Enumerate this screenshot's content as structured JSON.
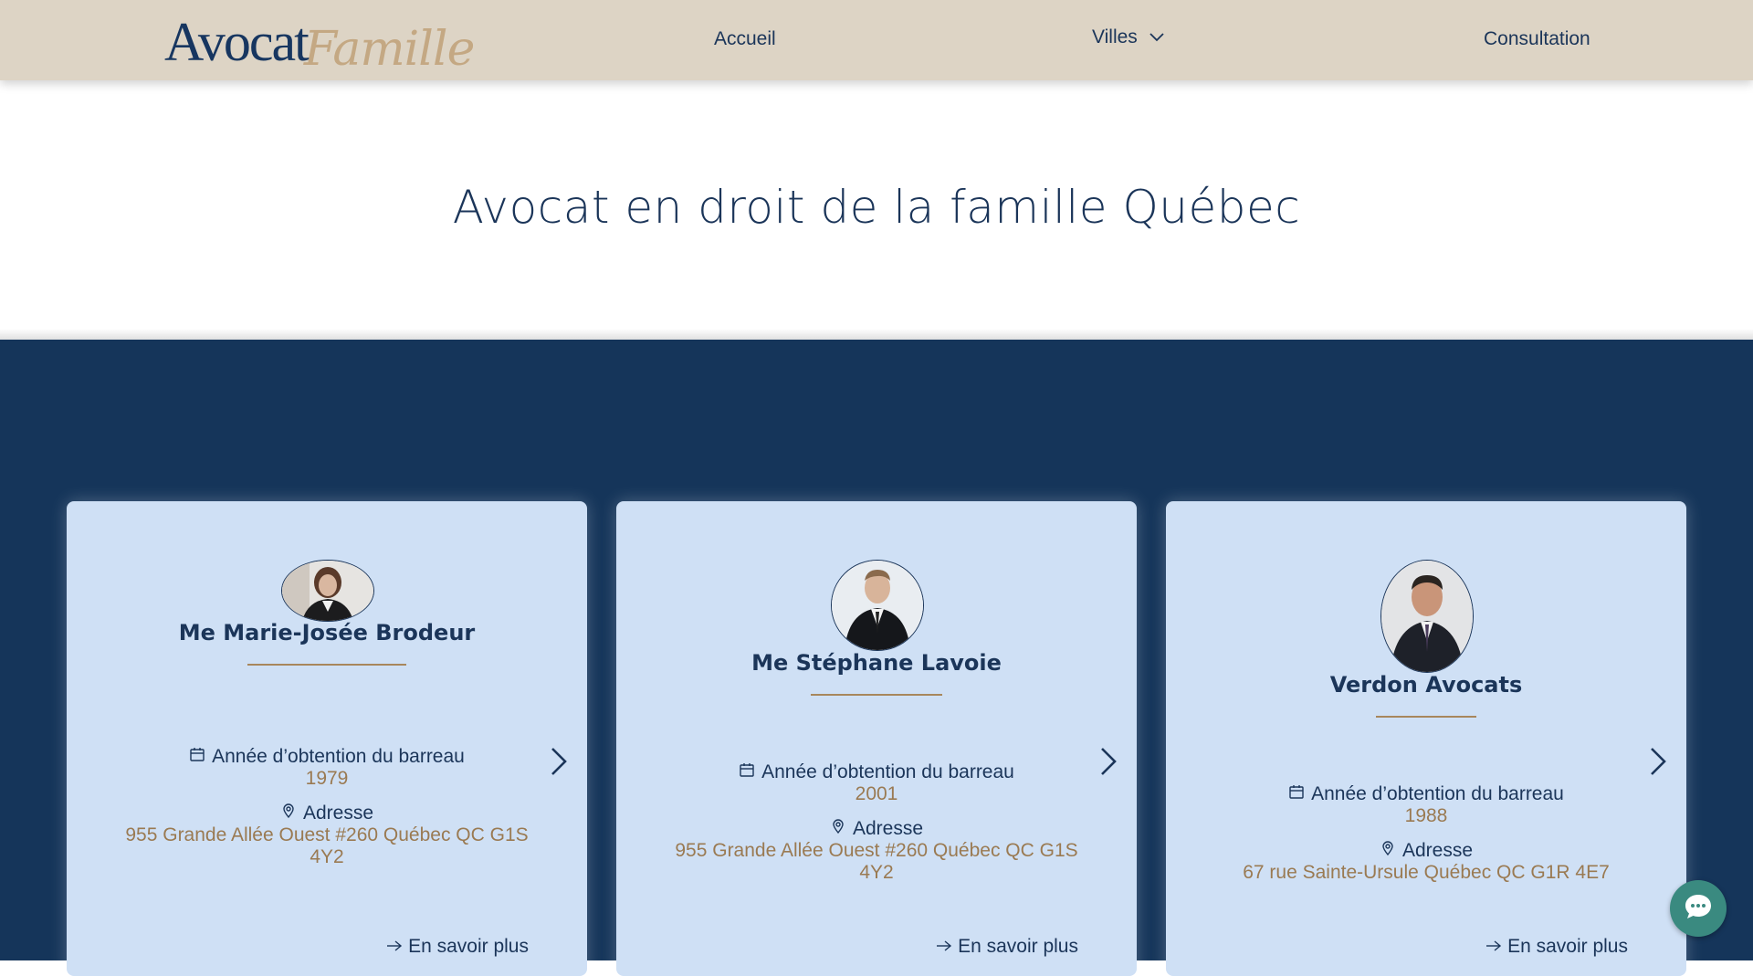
{
  "header": {
    "logo_part1": "Avocat",
    "logo_part2": "Famille",
    "nav": {
      "home": "Accueil",
      "cities": "Villes",
      "consultation": "Consultation"
    }
  },
  "hero": {
    "title": "Avocat en droit de la famille Québec"
  },
  "cards": [
    {
      "name": "Me Marie-Josée Brodeur",
      "year_label": "Année d’obtention du barreau",
      "year": "1979",
      "address_label": "Adresse",
      "address_line1": "955 Grande Allée Ouest #260 Québec QC G1S",
      "address_line2": "4Y2",
      "more": "En savoir plus"
    },
    {
      "name": "Me Stéphane Lavoie",
      "year_label": "Année d’obtention du barreau",
      "year": "2001",
      "address_label": "Adresse",
      "address_line1": "955 Grande Allée Ouest #260 Québec QC G1S",
      "address_line2": "4Y2",
      "more": "En savoir plus"
    },
    {
      "name": "Verdon Avocats",
      "year_label": "Année d’obtention du barreau",
      "year": "1988",
      "address_label": "Adresse",
      "address_line1": "67 rue Sainte-Ursule Québec QC G1R 4E7",
      "more": "En savoir plus"
    }
  ],
  "colors": {
    "header_bg": "#ddd4c5",
    "navy": "#1b3559",
    "section_bg": "#15355a",
    "card_bg": "#cfe0f5",
    "gold": "#9a7a52",
    "chat": "#3a8a80"
  },
  "icons": [
    "chevron-down-icon",
    "calendar-icon",
    "location-pin-icon",
    "chevron-right-icon",
    "arrow-right-icon",
    "chat-icon"
  ]
}
